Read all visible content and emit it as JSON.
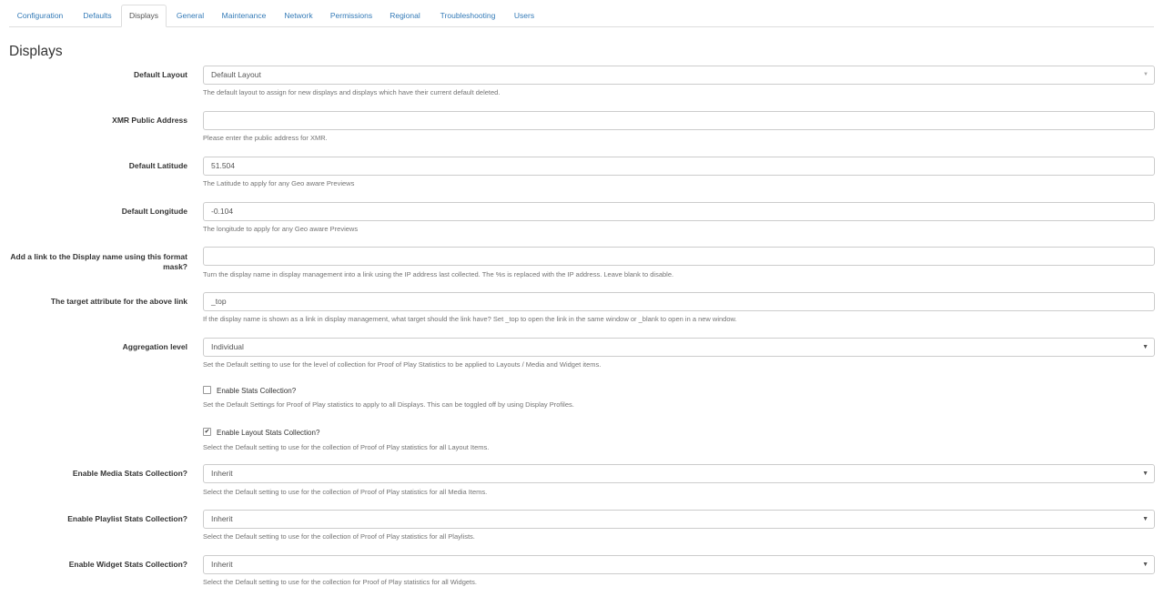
{
  "tabs": [
    {
      "label": "Configuration"
    },
    {
      "label": "Defaults"
    },
    {
      "label": "Displays",
      "active": true
    },
    {
      "label": "General"
    },
    {
      "label": "Maintenance"
    },
    {
      "label": "Network"
    },
    {
      "label": "Permissions"
    },
    {
      "label": "Regional"
    },
    {
      "label": "Troubleshooting"
    },
    {
      "label": "Users"
    }
  ],
  "page_title": "Displays",
  "fields": {
    "default_layout": {
      "label": "Default Layout",
      "value": "Default Layout",
      "help": "The default layout to assign for new displays and displays which have their current default deleted."
    },
    "xmr_address": {
      "label": "XMR Public Address",
      "value": "",
      "help": "Please enter the public address for XMR."
    },
    "default_latitude": {
      "label": "Default Latitude",
      "value": "51.504",
      "help": "The Latitude to apply for any Geo aware Previews"
    },
    "default_longitude": {
      "label": "Default Longitude",
      "value": "-0.104",
      "help": "The longitude to apply for any Geo aware Previews"
    },
    "link_format": {
      "label": "Add a link to the Display name using this format mask?",
      "value": "",
      "help": "Turn the display name in display management into a link using the IP address last collected. The %s is replaced with the IP address. Leave blank to disable."
    },
    "target_attribute": {
      "label": "The target attribute for the above link",
      "value": "_top",
      "help": "If the display name is shown as a link in display management, what target should the link have? Set _top to open the link in the same window or _blank to open in a new window."
    },
    "aggregation_level": {
      "label": "Aggregation level",
      "value": "Individual",
      "help": "Set the Default setting to use for the level of collection for Proof of Play Statistics to be applied to Layouts / Media and Widget items."
    },
    "stats_collection": {
      "label": "Enable Stats Collection?",
      "checked": false,
      "help": "Set the Default Settings for Proof of Play statistics to apply to all Displays. This can be toggled off by using Display Profiles."
    },
    "layout_stats": {
      "label": "Enable Layout Stats Collection?",
      "checked": true,
      "help": "Select the Default setting to use for the collection of Proof of Play statistics for all Layout Items."
    },
    "media_stats": {
      "label": "Enable Media Stats Collection?",
      "value": "Inherit",
      "help": "Select the Default setting to use for the collection of Proof of Play statistics for all Media Items."
    },
    "playlist_stats": {
      "label": "Enable Playlist Stats Collection?",
      "value": "Inherit",
      "help": "Select the Default setting to use for the collection of Proof of Play statistics for all Playlists."
    },
    "widget_stats": {
      "label": "Enable Widget Stats Collection?",
      "value": "Inherit",
      "help": "Select the Default setting to use for the collection for Proof of Play statistics for all Widgets."
    }
  },
  "icons": {
    "select_caret": "triangle-down",
    "checkbox_check": "check-mark"
  },
  "colors": {
    "link": "#337ab7",
    "help_text": "#737373",
    "border": "#cccccc"
  }
}
